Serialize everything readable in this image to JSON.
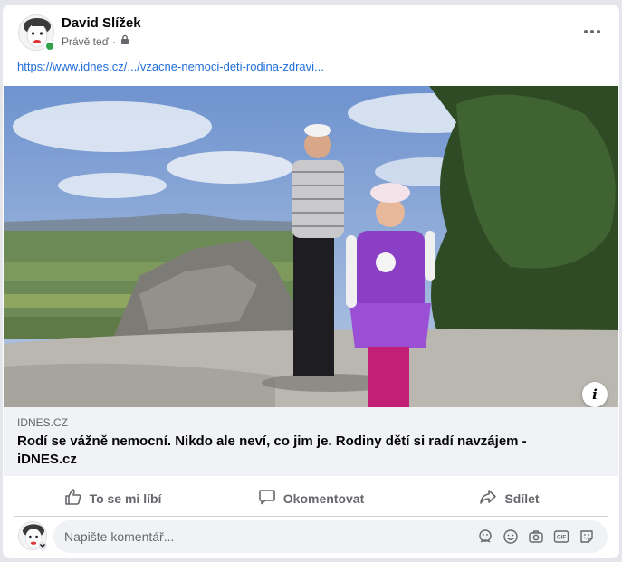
{
  "post": {
    "author": "David Slížek",
    "time": "Právě teď",
    "separator": "·",
    "privacy_icon": "lock-icon",
    "link_text": "https://www.idnes.cz/.../vzacne-nemoci-deti-rodina-zdravi..."
  },
  "link_card": {
    "domain": "IDNES.CZ",
    "headline": "Rodí se vážně nemocní. Nikdo ale neví, co jim je. Rodiny dětí si radí navzájem - iDNES.cz"
  },
  "actions": {
    "like": "To se mi líbí",
    "comment": "Okomentovat",
    "share": "Sdílet"
  },
  "comment": {
    "placeholder": "Napište komentář..."
  },
  "colors": {
    "link": "#216fdb",
    "secondary_text": "#65676b",
    "online": "#31a24c",
    "card_bg": "#f0f2f5"
  }
}
